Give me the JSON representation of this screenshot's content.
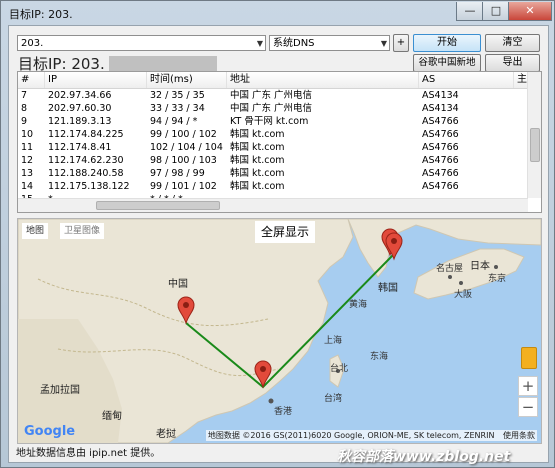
{
  "window": {
    "title": "目标IP: 203.",
    "buttons": [
      "—",
      "□",
      "✕"
    ]
  },
  "toolbar": {
    "ip_input_value": "203.",
    "dns_select_value": "系统DNS",
    "add_label": "+",
    "start_label": "开始",
    "clear_label": "清空",
    "google_map_label": "谷歌中国新地图",
    "export_label": "导出"
  },
  "target": {
    "label": "目标IP:",
    "value": "203."
  },
  "table": {
    "headers": [
      "#",
      "IP",
      "时间(ms)",
      "地址",
      "AS",
      "主机"
    ],
    "rows": [
      {
        "n": "7",
        "ip": "202.97.34.66",
        "time": "32 / 35 / 35",
        "addr": "中国 广东 广州电信",
        "as": "AS4134"
      },
      {
        "n": "8",
        "ip": "202.97.60.30",
        "time": "33 / 33 / 34",
        "addr": "中国 广东 广州电信",
        "as": "AS4134"
      },
      {
        "n": "9",
        "ip": "121.189.3.13",
        "time": "94 / 94 / *",
        "addr": "KT 骨干网 kt.com",
        "as": "AS4766"
      },
      {
        "n": "10",
        "ip": "112.174.84.225",
        "time": "99 / 100 / 102",
        "addr": "韩国 kt.com",
        "as": "AS4766"
      },
      {
        "n": "11",
        "ip": "112.174.8.41",
        "time": "102 / 104 / 104",
        "addr": "韩国 kt.com",
        "as": "AS4766"
      },
      {
        "n": "12",
        "ip": "112.174.62.230",
        "time": "98 / 100 / 103",
        "addr": "韩国 kt.com",
        "as": "AS4766"
      },
      {
        "n": "13",
        "ip": "112.188.240.58",
        "time": "97 / 98 / 99",
        "addr": "韩国 kt.com",
        "as": "AS4766"
      },
      {
        "n": "14",
        "ip": "112.175.138.122",
        "time": "99 / 101 / 102",
        "addr": "韩国 kt.com",
        "as": "AS4766"
      },
      {
        "n": "15",
        "ip": "*",
        "time": "* / * / *",
        "addr": "",
        "as": ""
      }
    ]
  },
  "map": {
    "type_map": "地图",
    "type_satellite": "卫星图像",
    "fullscreen_label": "全屏显示",
    "labels": {
      "china": "中国",
      "korea": "韩国",
      "yellow_sea": "黄海",
      "east_sea": "东海",
      "shanghai": "上海",
      "nagoya": "名古屋",
      "tokyo": "东京",
      "japan": "日本",
      "osaka": "大阪",
      "taipei": "台北",
      "taiwan": "台湾",
      "hongkong": "香港",
      "bangladesh": "孟加拉国",
      "myanmar": "缅甸",
      "laos": "老挝"
    },
    "attribution": "地图数据 ©2016 GS(2011)6020 Google, ORION-ME, SK telecom, ZENRIN",
    "terms": "使用条款",
    "google_logo": "Google",
    "zoom_in": "+",
    "zoom_out": "−",
    "route_color": "#1a8a1a"
  },
  "footer": {
    "text": "地址数据信息由 ipip.net 提供。"
  },
  "watermark": "秋容部落www.zblog.net"
}
